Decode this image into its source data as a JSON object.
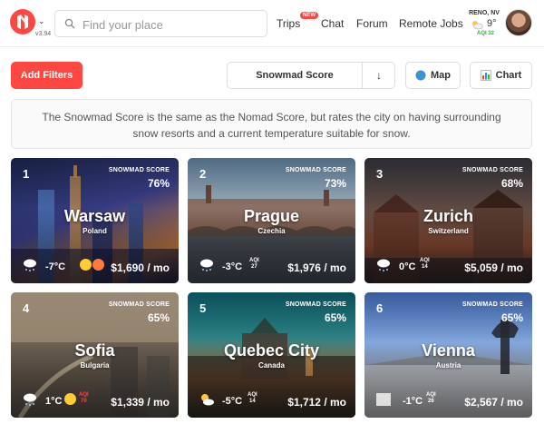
{
  "header": {
    "version": "v3.94",
    "search_placeholder": "Find your place",
    "nav": {
      "trips": "Trips",
      "new_badge": "NEW",
      "chat": "Chat",
      "forum": "Forum",
      "remote_jobs": "Remote Jobs"
    },
    "location": "RENO, NV",
    "temperature": "9°",
    "aqi": "AQI 32"
  },
  "toolbar": {
    "add_filters": "Add Filters",
    "sort_label": "Snowmad Score",
    "sort_direction": "↓",
    "map": "Map",
    "chart": "Chart"
  },
  "info_text": "The Snowmad Score is the same as the Nomad Score, but rates the city on having surrounding snow resorts and a current temperature suitable for snow.",
  "cards": [
    {
      "rank": "1",
      "score_label": "SNOWMAD SCORE",
      "score": "76%",
      "city": "Warsaw",
      "country": "Poland",
      "temp": "-7°C",
      "aqi": "",
      "aqi_value": "",
      "cost": "$1,690 / mo",
      "weather": "snow-cloud-icon"
    },
    {
      "rank": "2",
      "score_label": "SNOWMAD SCORE",
      "score": "73%",
      "city": "Prague",
      "country": "Czechia",
      "temp": "-3°C",
      "aqi": "AQI",
      "aqi_value": "27",
      "cost": "$1,976 / mo",
      "weather": "snow-cloud-icon"
    },
    {
      "rank": "3",
      "score_label": "SNOWMAD SCORE",
      "score": "68%",
      "city": "Zurich",
      "country": "Switzerland",
      "temp": "0°C",
      "aqi": "AQI",
      "aqi_value": "14",
      "cost": "$5,059 / mo",
      "weather": "snow-cloud-icon"
    },
    {
      "rank": "4",
      "score_label": "SNOWMAD SCORE",
      "score": "65%",
      "city": "Sofia",
      "country": "Bulgaria",
      "temp": "1°C",
      "aqi": "AQI",
      "aqi_value": "70",
      "cost": "$1,339 / mo",
      "weather": "snow-cloud-icon"
    },
    {
      "rank": "5",
      "score_label": "SNOWMAD SCORE",
      "score": "65%",
      "city": "Quebec City",
      "country": "Canada",
      "temp": "-5°C",
      "aqi": "AQI",
      "aqi_value": "14",
      "cost": "$1,712 / mo",
      "weather": "sun-cloud-icon"
    },
    {
      "rank": "6",
      "score_label": "SNOWMAD SCORE",
      "score": "65%",
      "city": "Vienna",
      "country": "Austria",
      "temp": "-1°C",
      "aqi": "AQI",
      "aqi_value": "26",
      "cost": "$2,567 / mo",
      "weather": "fog-icon"
    }
  ],
  "colors": {
    "accent": "#ff4742",
    "aqi_good": "#2eb82e",
    "aqi_bad": "#ff4742"
  }
}
